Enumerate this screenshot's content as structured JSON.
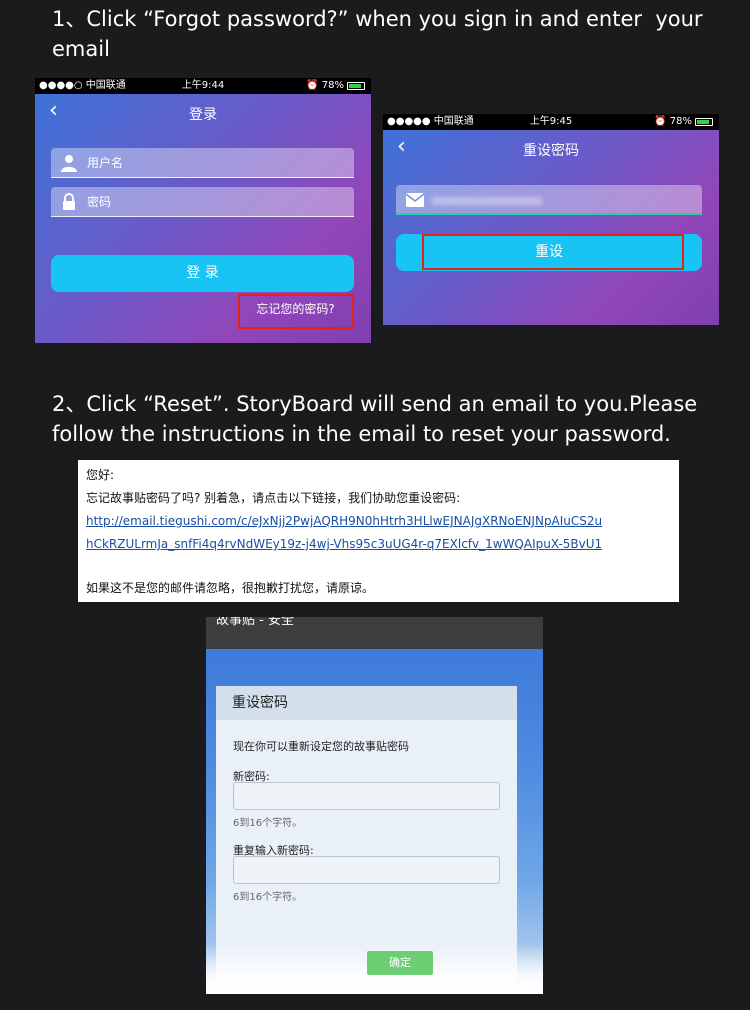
{
  "step1": {
    "text": "1、Click  “Forgot password?”  when you sign in and enter  your email"
  },
  "phone1": {
    "status": {
      "carrier": "●●●●○ 中国联通",
      "time": "上午9:44",
      "battery": "78%"
    },
    "title": "登录",
    "username_placeholder": "用户名",
    "password_placeholder": "密码",
    "login_label": "登 录",
    "forgot_label": "忘记您的密码?"
  },
  "phone2": {
    "status": {
      "carrier": "●●●●● 中国联通",
      "time": "上午9:45",
      "battery": "78%"
    },
    "title": "重设密码",
    "reset_label": "重设"
  },
  "step2": {
    "text": "2、Click “Reset”. StoryBoard will send an email to you.Please follow the instructions in the email to reset your password."
  },
  "email": {
    "greeting": "您好:",
    "line1": "忘记故事贴密码了吗? 别着急，请点击以下链接，我们协助您重设密码:",
    "link1": "http://email.tiegushi.com/c/eJxNjj2PwjAQRH9N0hHtrh3HLlwEJNAJgXRNoENJNpAIuCS2u",
    "link2": "hCkRZULrmJa_snfFi4q4rvNdWEy19z-j4wj-Vhs95c3uUG4r-q7EXlcfv_1wWQAIpuX-5BvU1",
    "footer": "如果这不是您的邮件请忽略，很抱歉打扰您，请原谅。"
  },
  "web": {
    "topbar": "故事贴 - 安全",
    "panel_title": "重设密码",
    "description": "现在你可以重新设定您的故事贴密码",
    "new_password_label": "新密码:",
    "new_password_hint": "6到16个字符。",
    "repeat_password_label": "重复输入新密码:",
    "repeat_password_hint": "6到16个字符。",
    "confirm_label": "确定"
  },
  "colors": {
    "accent_button": "#18c4f3",
    "highlight_box": "#e2231a",
    "confirm_button": "#6ccf73"
  }
}
